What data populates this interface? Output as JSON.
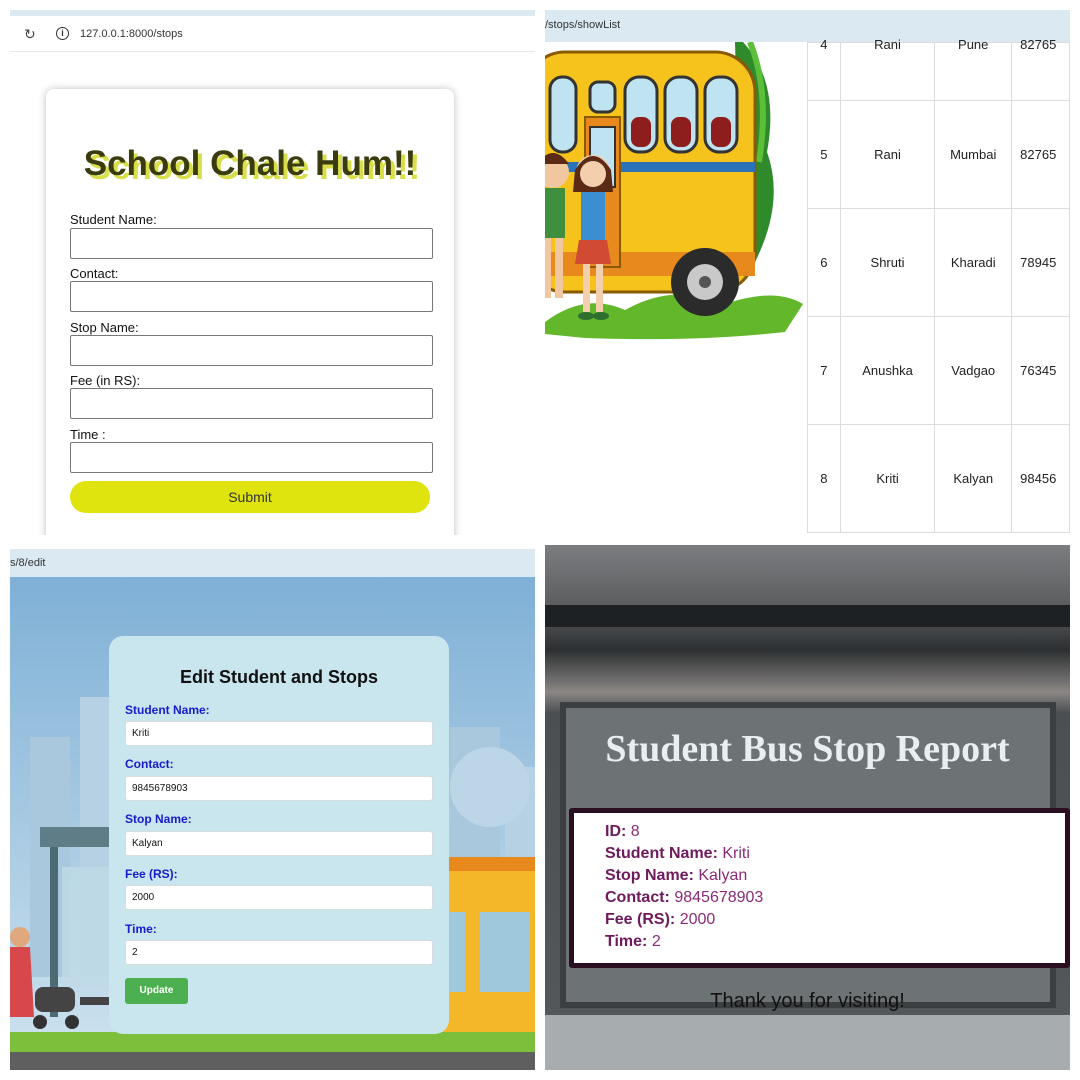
{
  "form_page": {
    "url": "127.0.0.1:8000/stops",
    "reload_icon": "↻",
    "info_icon": "i",
    "title": "School Chale Hum!!",
    "labels": [
      "Student Name:",
      "Contact:",
      "Stop Name:",
      "Fee (in RS):",
      "Time :"
    ],
    "submit_label": "Submit",
    "colors": {
      "title": "#3b3b10",
      "title_shadow": "#d8df4a",
      "submit_bg": "#dfe30e"
    }
  },
  "list_page": {
    "url": "/stops/showList",
    "image": "school-bus-with-children",
    "rows": [
      {
        "id": "4",
        "name": "Rani",
        "stop": "Pune",
        "contact": "82765"
      },
      {
        "id": "5",
        "name": "Rani",
        "stop": "Mumbai",
        "contact": "82765"
      },
      {
        "id": "6",
        "name": "Shruti",
        "stop": "Kharadi",
        "contact": "78945"
      },
      {
        "id": "7",
        "name": "Anushka",
        "stop": "Vadgao",
        "contact": "76345"
      },
      {
        "id": "8",
        "name": "Kriti",
        "stop": "Kalyan",
        "contact": "98456"
      }
    ]
  },
  "edit_page": {
    "url": "s/8/edit",
    "title": "Edit Student and Stops",
    "fields": [
      {
        "label": "Student Name:",
        "value": "Kriti"
      },
      {
        "label": "Contact:",
        "value": "9845678903"
      },
      {
        "label": "Stop Name:",
        "value": "Kalyan"
      },
      {
        "label": "Fee (RS):",
        "value": "2000"
      },
      {
        "label": "Time:",
        "value": "2"
      }
    ],
    "update_label": "Update",
    "colors": {
      "card": "#c9e6ee",
      "label": "#1a1acc",
      "button": "#4caf50"
    }
  },
  "report_page": {
    "title": "Student Bus Stop Report",
    "items": [
      {
        "label": "ID:",
        "value": "8"
      },
      {
        "label": "Student Name:",
        "value": "Kriti"
      },
      {
        "label": "Stop Name:",
        "value": "Kalyan"
      },
      {
        "label": "Contact:",
        "value": "9845678903"
      },
      {
        "label": "Fee (RS):",
        "value": "2000"
      },
      {
        "label": "Time:",
        "value": "2"
      }
    ],
    "footer": "Thank you for visiting!",
    "colors": {
      "text": "#8a2a77",
      "border": "#2a0f22"
    }
  }
}
